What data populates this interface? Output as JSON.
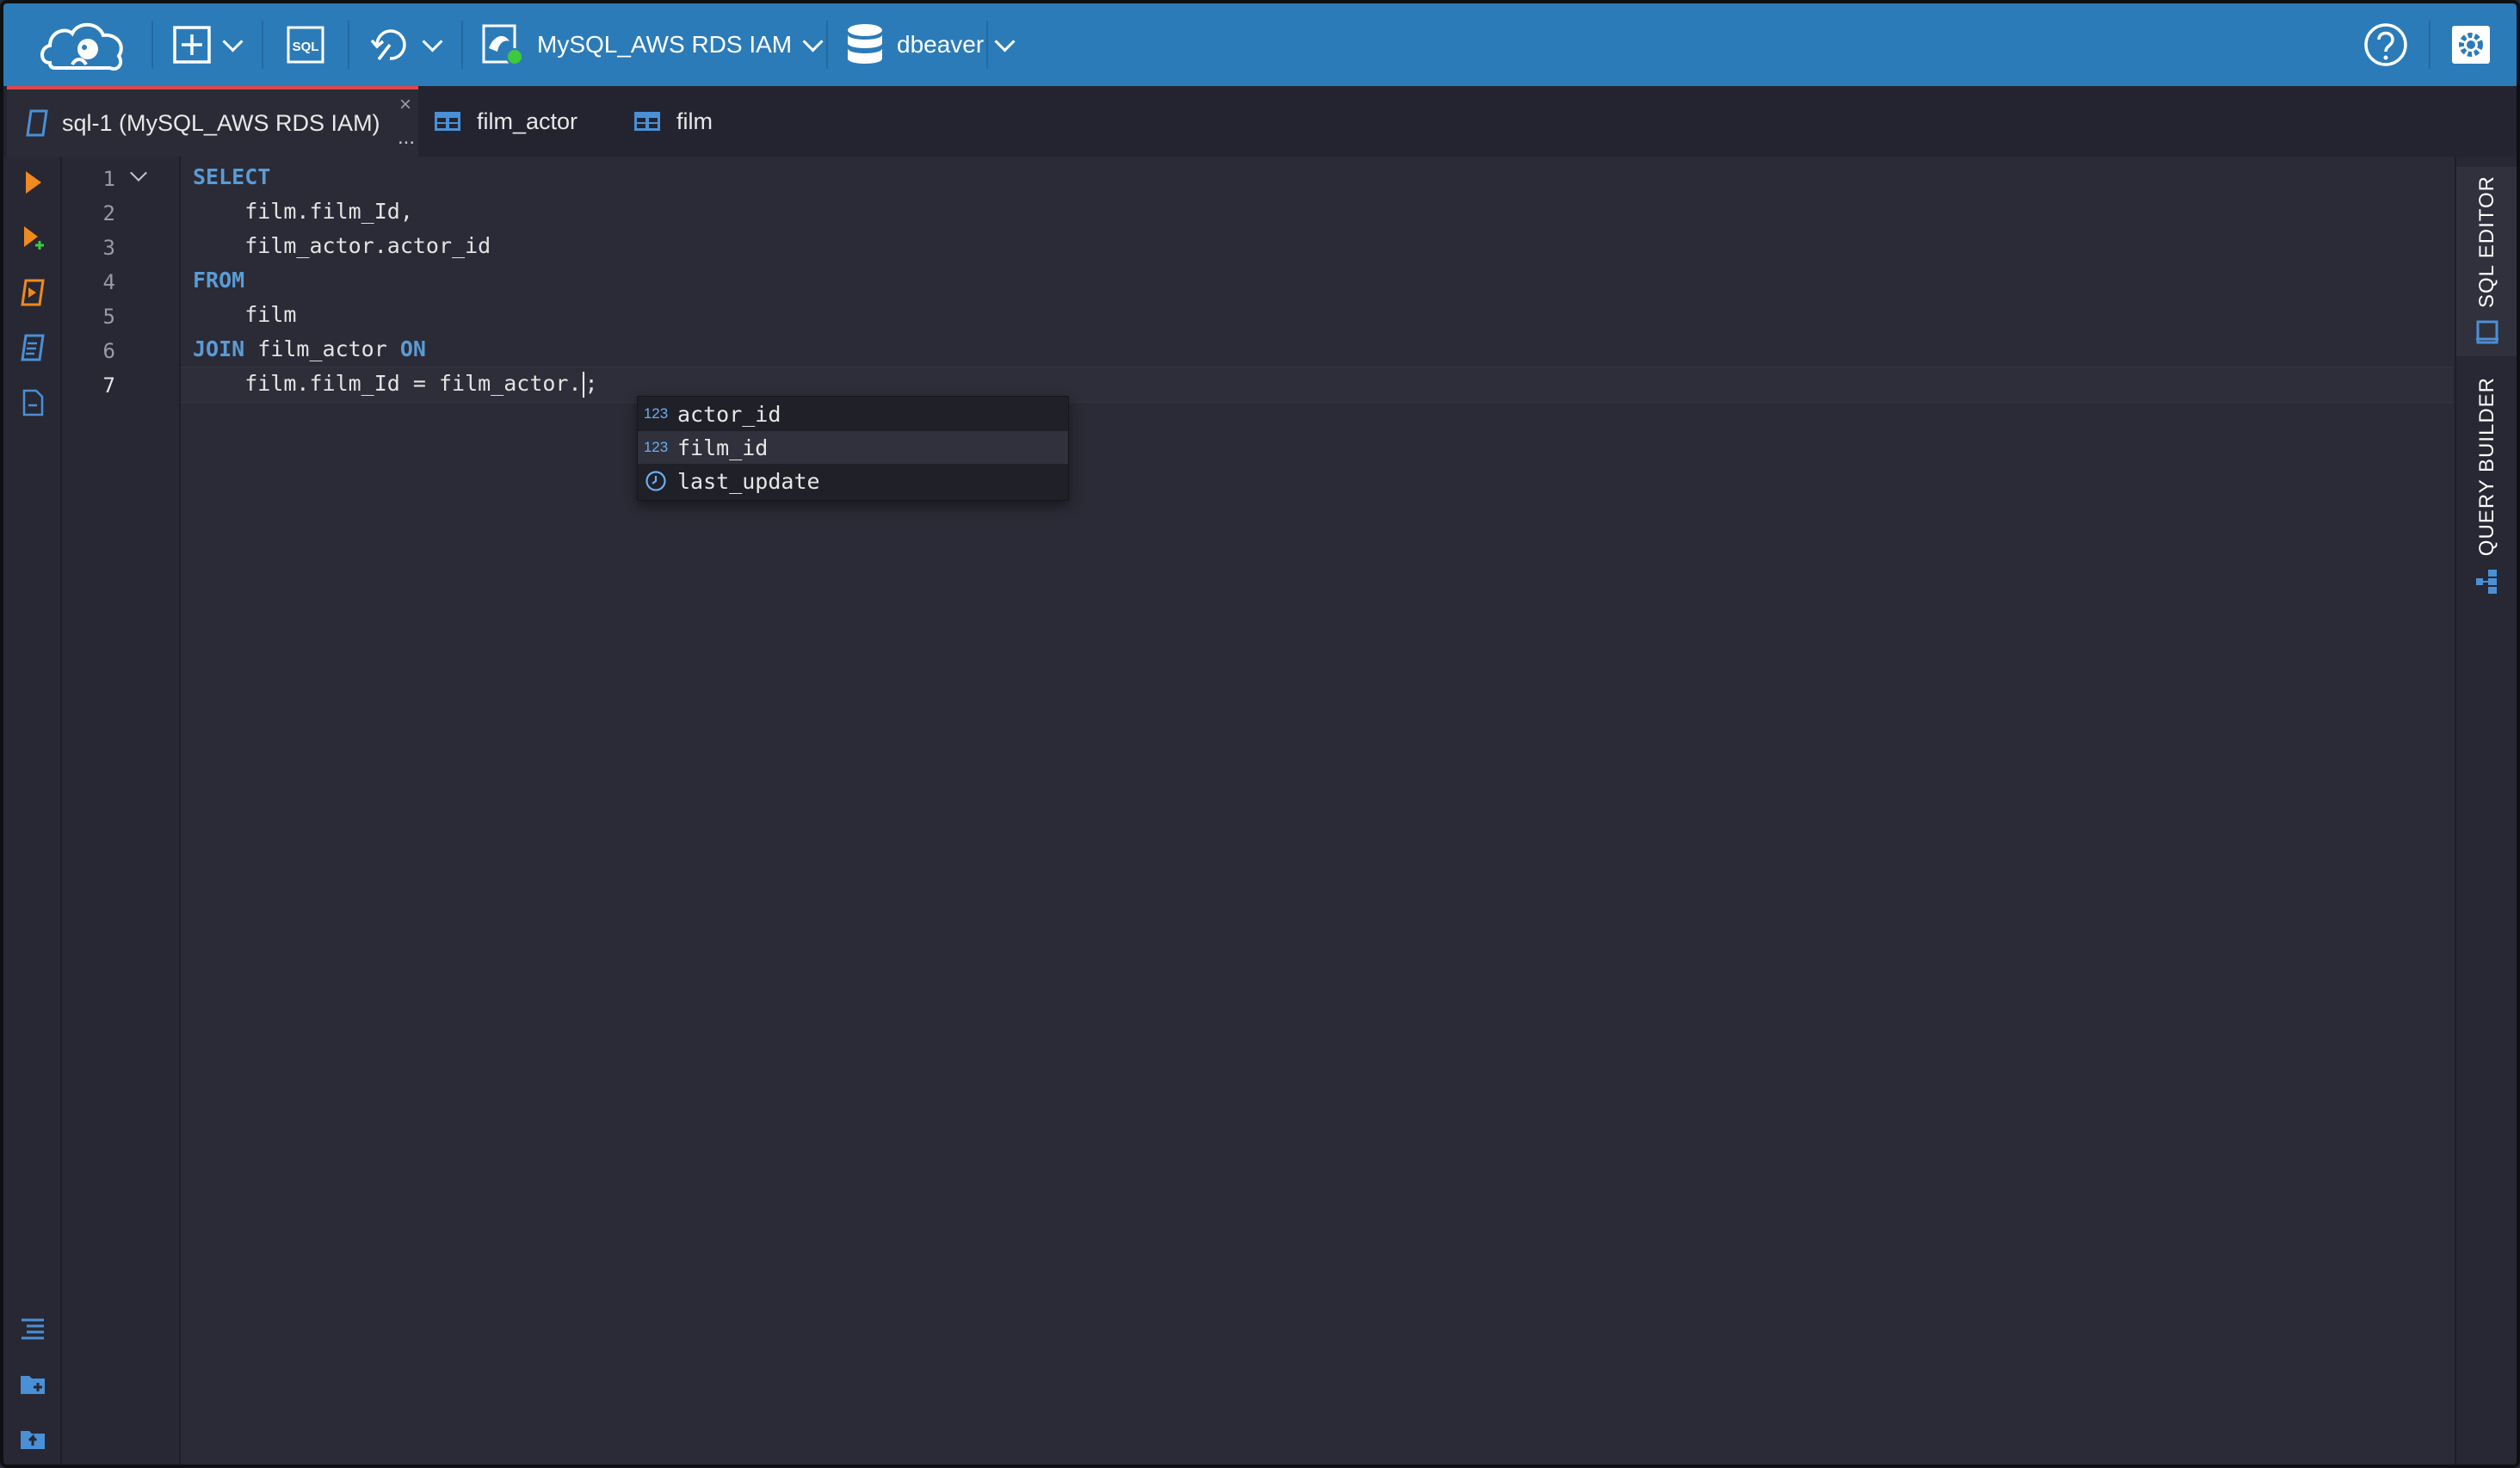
{
  "topbar": {
    "connection_label": "MySQL_AWS RDS IAM",
    "database_label": "dbeaver",
    "sql_icon_text": "SQL"
  },
  "tabs": [
    {
      "label": "sql-1 (MySQL_AWS RDS IAM)",
      "overflow": "...",
      "close": "×"
    },
    {
      "label": "film_actor"
    },
    {
      "label": "film"
    }
  ],
  "editor": {
    "line_numbers": [
      "1",
      "2",
      "3",
      "4",
      "5",
      "6",
      "7"
    ],
    "lines": [
      {
        "kw": "SELECT",
        "text": ""
      },
      {
        "kw": "",
        "text": "    film.film_Id,"
      },
      {
        "kw": "",
        "text": "    film_actor.actor_id"
      },
      {
        "kw": "FROM",
        "text": ""
      },
      {
        "kw": "",
        "text": "    film"
      },
      {
        "kw1": "JOIN",
        "text": " film_actor ",
        "kw2": "ON"
      },
      {
        "before": "    film.film_Id = film_actor.",
        "after": ";"
      }
    ]
  },
  "autocomplete": {
    "items": [
      {
        "type": "123",
        "label": "actor_id"
      },
      {
        "type": "123",
        "label": "film_id"
      },
      {
        "type": "clock-icon",
        "label": "last_update"
      }
    ]
  },
  "right_panel": {
    "sql_editor_label": "SQL EDITOR",
    "query_builder_label": "QUERY BUILDER"
  },
  "colors": {
    "topbar": "#2b7bb9",
    "keyword": "#5b9bd5",
    "accent_tab": "#e0464a",
    "run_icon": "#f0891e"
  }
}
